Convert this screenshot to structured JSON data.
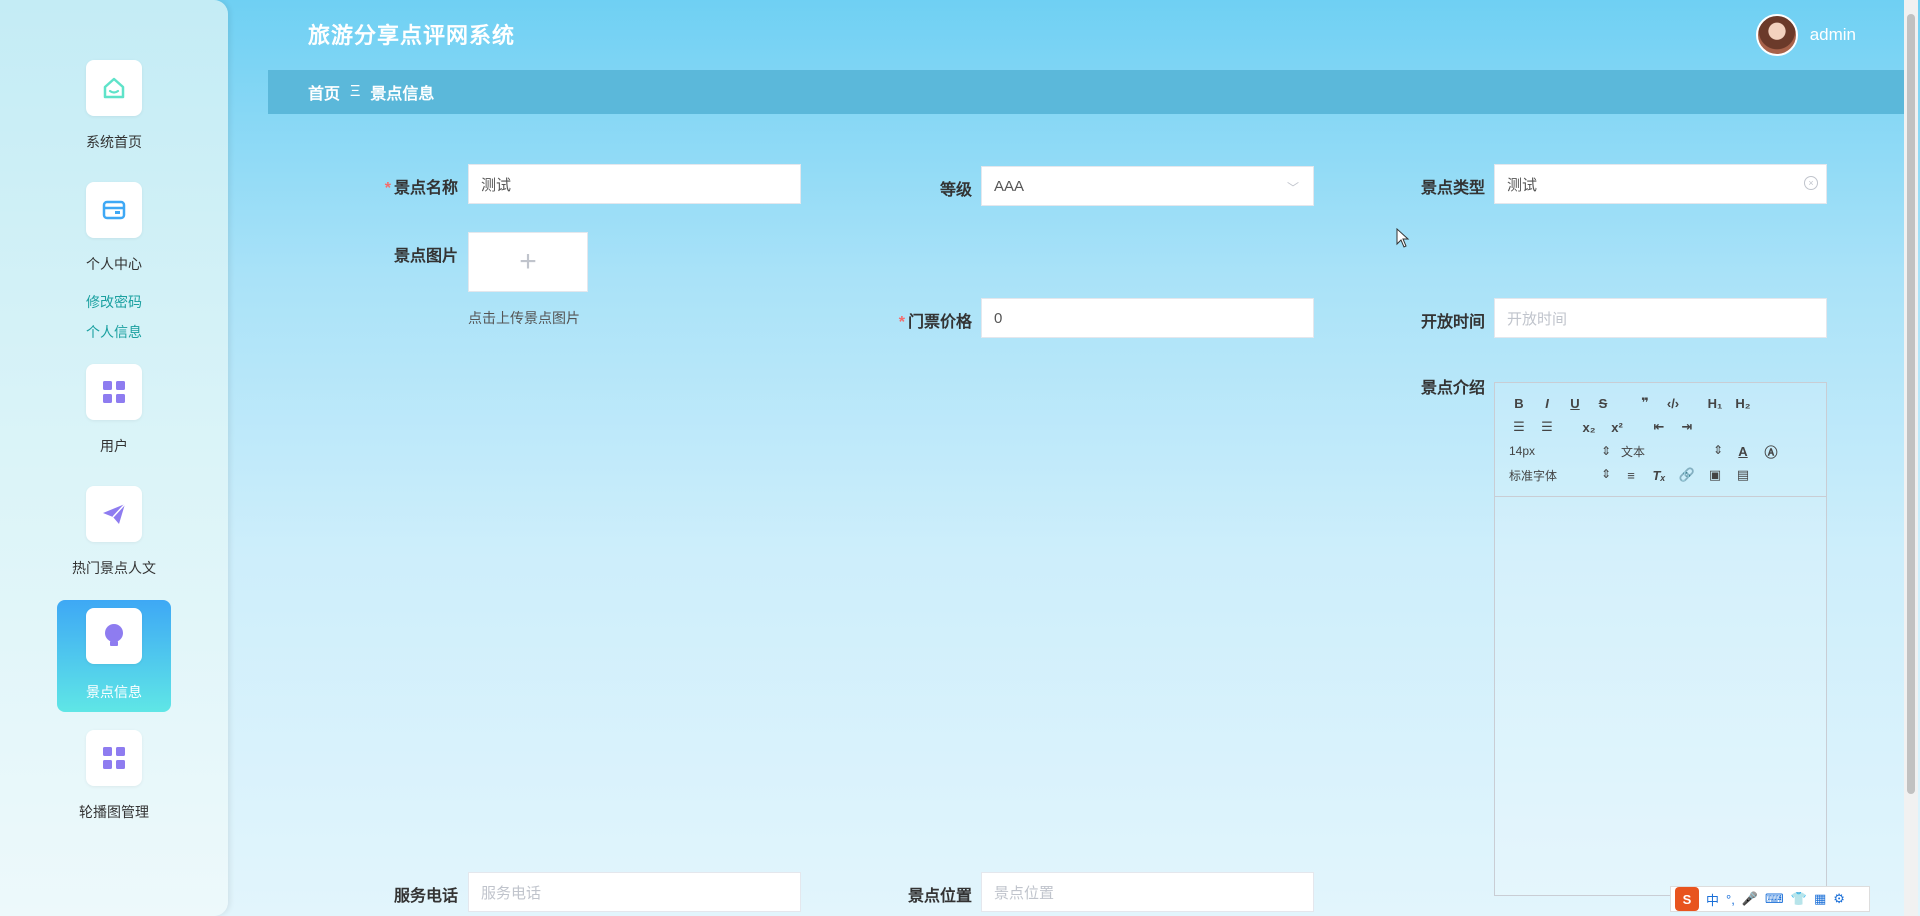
{
  "app": {
    "title": "旅游分享点评网系统"
  },
  "user": {
    "name": "admin"
  },
  "breadcrumb": {
    "home": "首页",
    "sep": "Ξ",
    "current": "景点信息"
  },
  "sidebar": {
    "items": [
      {
        "label": "系统首页",
        "icon": "home-icon"
      },
      {
        "label": "个人中心",
        "icon": "wallet-icon"
      },
      {
        "label": "用户",
        "icon": "grid-icon"
      },
      {
        "label": "热门景点人文",
        "icon": "send-icon"
      },
      {
        "label": "景点信息",
        "icon": "bulb-icon",
        "active": true
      },
      {
        "label": "轮播图管理",
        "icon": "grid-icon"
      }
    ],
    "sub_links": [
      "修改密码",
      "个人信息"
    ]
  },
  "form": {
    "name": {
      "label": "景点名称",
      "value": "测试"
    },
    "level": {
      "label": "等级",
      "value": "AAA"
    },
    "type": {
      "label": "景点类型",
      "value": "测试"
    },
    "image": {
      "label": "景点图片",
      "plus": "+",
      "hint": "点击上传景点图片"
    },
    "price": {
      "label": "门票价格",
      "value": "0"
    },
    "open_time": {
      "label": "开放时间",
      "placeholder": "开放时间"
    },
    "intro": {
      "label": "景点介绍"
    },
    "phone": {
      "label": "服务电话",
      "placeholder": "服务电话"
    },
    "location": {
      "label": "景点位置",
      "placeholder": "景点位置"
    }
  },
  "editor": {
    "font_size": "14px",
    "text_style": "文本",
    "font_family": "标准字体"
  },
  "colors": {
    "accent": "#3ea8f5",
    "required": "#f56c6c",
    "breadcrumb_bg": "#5bb8da"
  }
}
